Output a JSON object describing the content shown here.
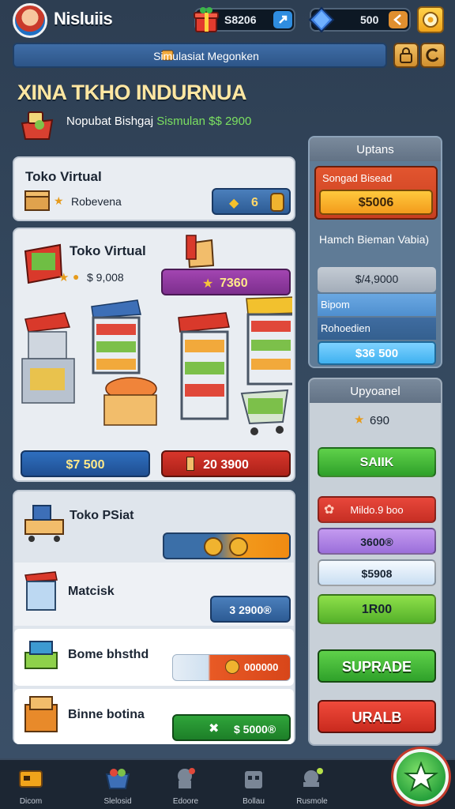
{
  "header": {
    "username": "Nisluiis",
    "coins": "S8206",
    "gems": "500"
  },
  "banner": {
    "text": "Simulasiat Megonken"
  },
  "title": "XINA TKHO INDURNUA",
  "subtitle": {
    "label": "Nopubat Bishgaj",
    "money": "Sismulan $$ 2900"
  },
  "cards": {
    "card1": {
      "title": "Toko Virtual",
      "subtitle": "Robevena",
      "pill_value": "6"
    },
    "card2": {
      "title": "Toko Virtual",
      "stat": "$ 9,008",
      "pill_value": "7360",
      "buy_value": "$7 500",
      "sell_value": "20 3900"
    },
    "list": [
      {
        "title": "Toko PSiat",
        "pill_value": ""
      },
      {
        "title": "Matcisk",
        "pill_value": "3 2900®"
      },
      {
        "title": "Bome bhsthd",
        "pill_value": "000000"
      },
      {
        "title": "Binne botina",
        "pill_value": "$ 5000®"
      }
    ]
  },
  "upgrades_panel": {
    "title": "Uptans",
    "orange_label": "Songad Bisead",
    "orange_value": "$5006",
    "desc": "Hamch Bieman Vabia)",
    "gray_value": "$/4,9000",
    "blue1": "Bipom",
    "blue2": "Rohoedien",
    "blue3": "$36 500"
  },
  "upgrade_panel2": {
    "title": "Upyoanel",
    "star_value": "690",
    "green1": "SAIIK",
    "red_value": "Mildo.9 boo",
    "purple_value": "3600®",
    "white_value": "$5908",
    "green2": "1R00",
    "suprade": "SUPRADE",
    "urali": "URALB"
  },
  "nav": [
    {
      "label": "Dicom"
    },
    {
      "label": "Slelosid"
    },
    {
      "label": "Edoore"
    },
    {
      "label": "Bollau"
    },
    {
      "label": "Rusmole"
    }
  ],
  "colors": {
    "accent_green": "#3fbf3b",
    "accent_orange": "#f39b1c",
    "accent_red": "#d9322a",
    "title_gold": "#ffe7a2"
  }
}
